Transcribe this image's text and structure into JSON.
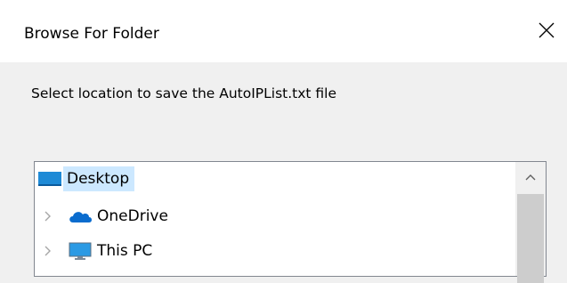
{
  "window": {
    "title": "Browse For Folder",
    "close_icon": "close-icon"
  },
  "instruction": "Select location to save the AutoIPList.txt file",
  "tree": {
    "items": [
      {
        "label": "Desktop",
        "icon": "desktop-icon",
        "selected": true,
        "expandable": false
      },
      {
        "label": "OneDrive",
        "icon": "onedrive-cloud-icon",
        "selected": false,
        "expandable": true
      },
      {
        "label": "This PC",
        "icon": "computer-icon",
        "selected": false,
        "expandable": true
      }
    ]
  },
  "colors": {
    "selection": "#cce8ff",
    "titlebar": "#ffffff",
    "dialog_bg": "#f0f0f0",
    "onedrive_blue": "#0a6cce",
    "desktop_blue": "#1e8ad6"
  }
}
